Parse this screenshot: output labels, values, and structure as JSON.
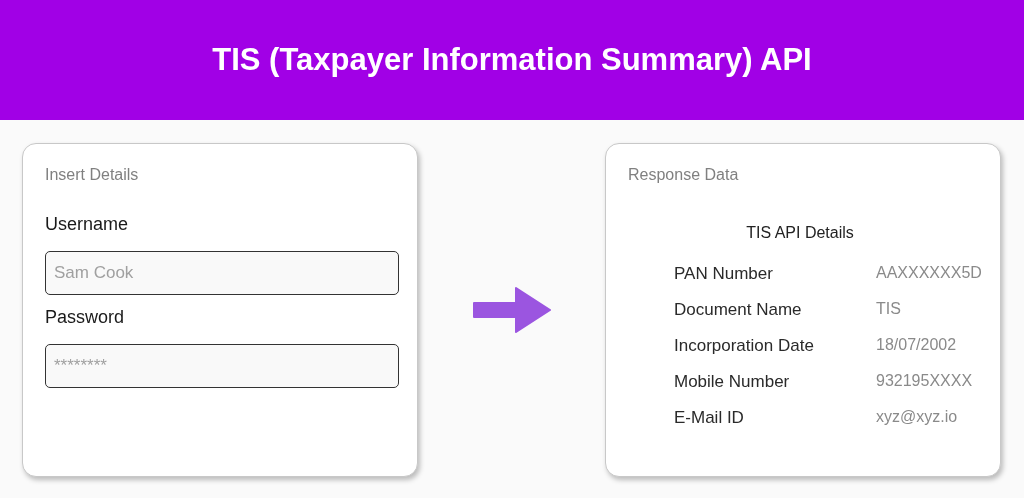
{
  "header": {
    "title": "TIS (Taxpayer Information Summary) API"
  },
  "input_card": {
    "title": "Insert Details",
    "fields": [
      {
        "label": "Username",
        "placeholder": "Sam Cook"
      },
      {
        "label": "Password",
        "placeholder": "********"
      }
    ]
  },
  "response_card": {
    "title": "Response Data",
    "heading": "TIS API Details",
    "rows": [
      {
        "label": "PAN Number",
        "value": "AAXXXXXX5D"
      },
      {
        "label": "Document Name",
        "value": "TIS"
      },
      {
        "label": "Incorporation Date",
        "value": "18/07/2002"
      },
      {
        "label": "Mobile Number",
        "value": "932195XXXX"
      },
      {
        "label": "E-Mail ID",
        "value": "xyz@xyz.io"
      }
    ]
  }
}
